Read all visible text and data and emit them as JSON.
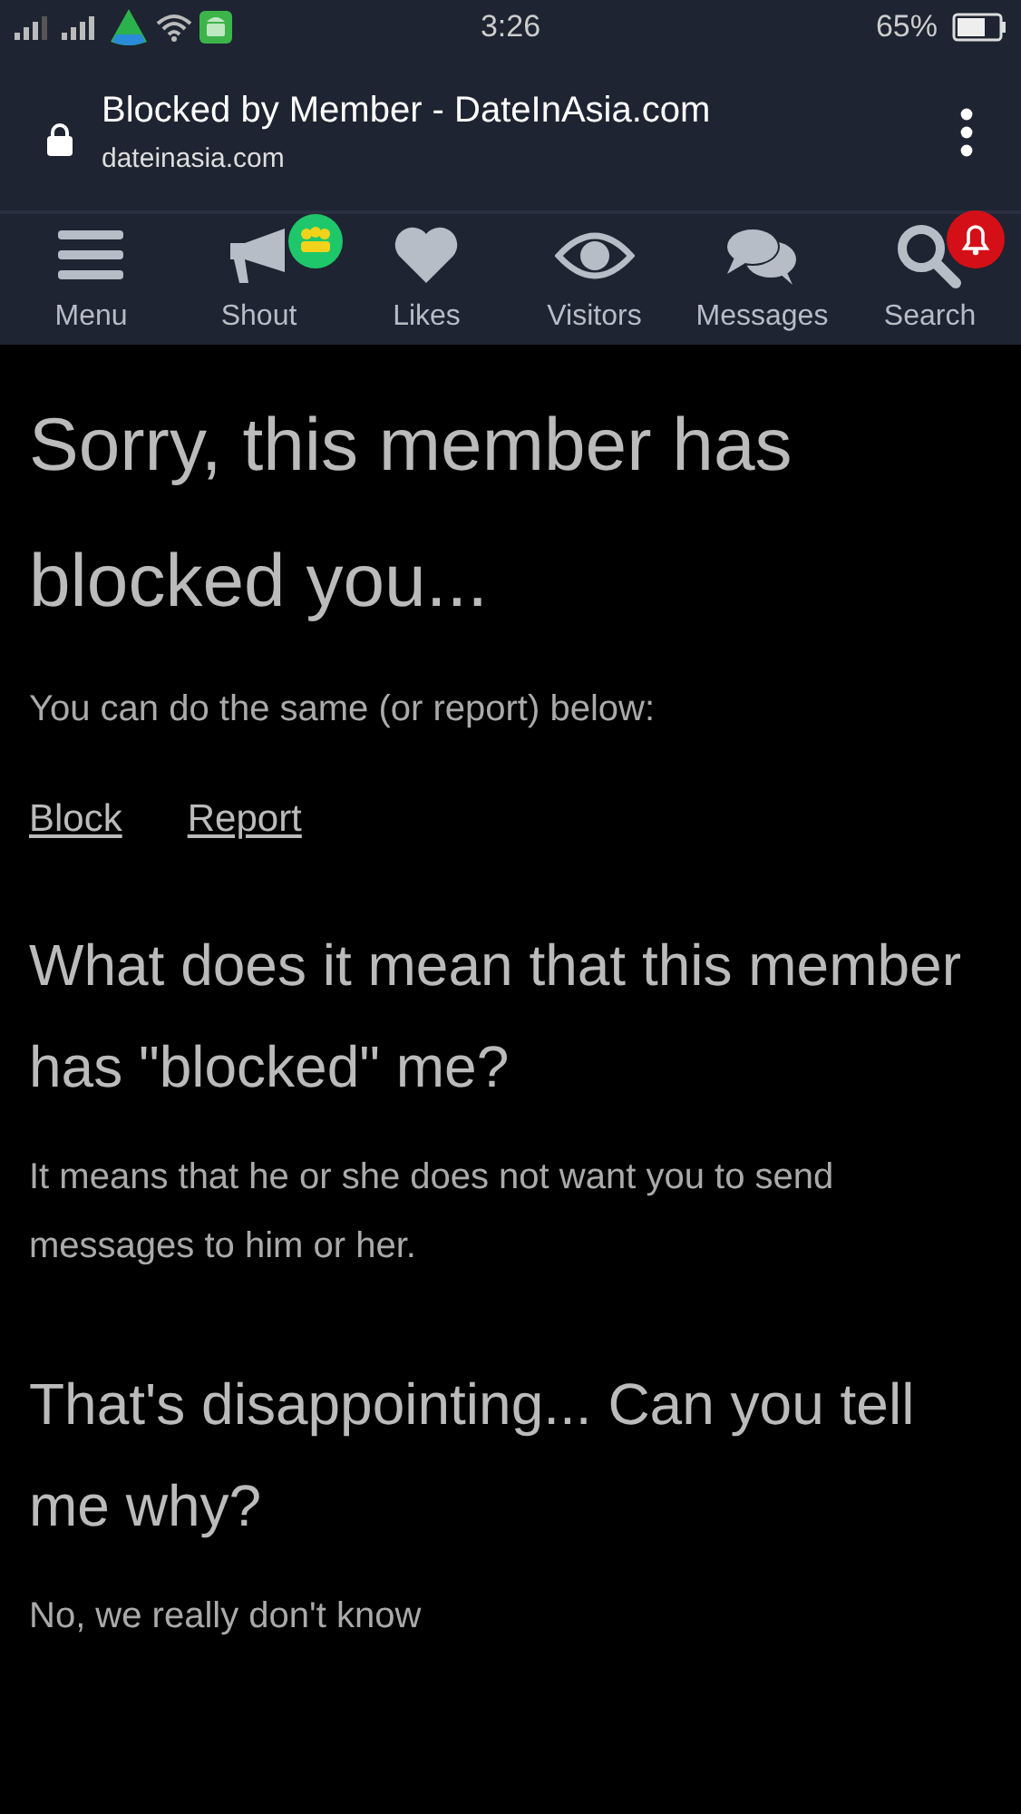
{
  "status_bar": {
    "time": "3:26",
    "battery": "65%"
  },
  "browser": {
    "title": "Blocked by Member - DateInAsia.com",
    "url": "dateinasia.com"
  },
  "nav": [
    {
      "label": "Menu",
      "kind": "menu"
    },
    {
      "label": "Shout",
      "kind": "shout"
    },
    {
      "label": "Likes",
      "kind": "likes"
    },
    {
      "label": "Visitors",
      "kind": "visitors"
    },
    {
      "label": "Messages",
      "kind": "messages"
    },
    {
      "label": "Search",
      "kind": "search"
    }
  ],
  "content": [
    {
      "kind": "h1",
      "text": "Sorry, this member has blocked you..."
    },
    {
      "kind": "p",
      "text": "You can do the same (or report) below:"
    },
    {
      "kind": "links",
      "links": [
        "Block",
        "Report"
      ]
    },
    {
      "kind": "h2",
      "text": "What does it mean that this member has \"blocked\" me?"
    },
    {
      "kind": "p",
      "text": "It means that he or she does not want you to send messages to him or her."
    },
    {
      "kind": "h2",
      "text": "That's disappointing... Can you tell me why?"
    },
    {
      "kind": "p",
      "text": "No, we really don't know"
    }
  ]
}
